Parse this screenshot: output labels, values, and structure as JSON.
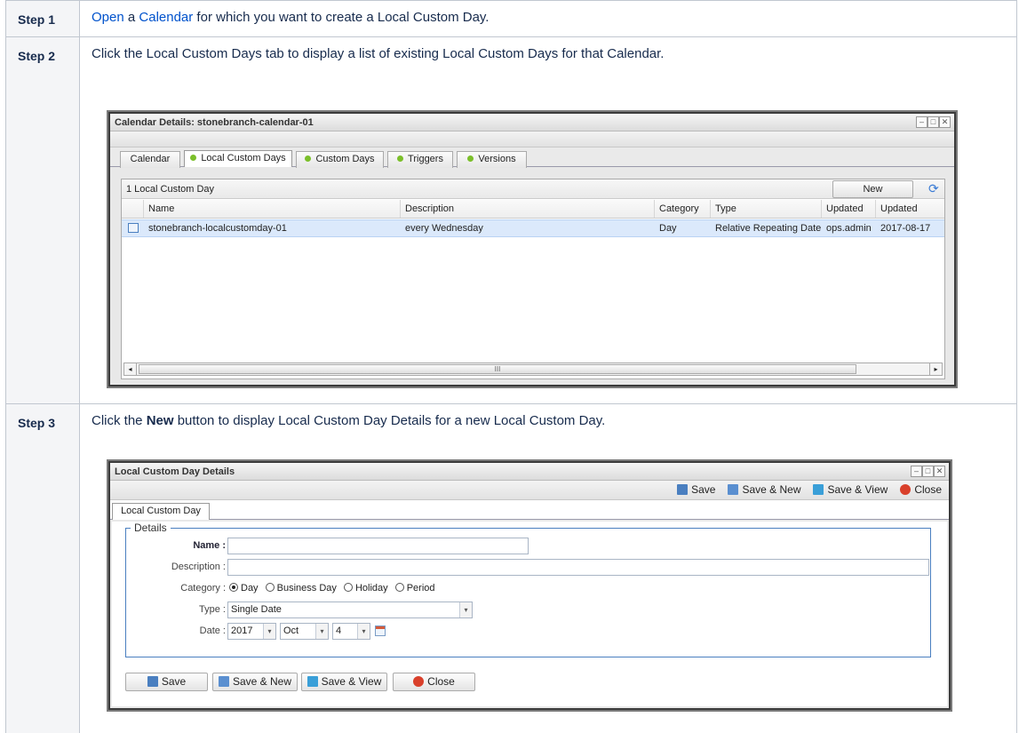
{
  "steps": [
    {
      "label": "Step 1"
    },
    {
      "label": "Step 2",
      "text": "Click the Local Custom Days tab to display a list of existing Local Custom Days for that Calendar."
    },
    {
      "label": "Step 3",
      "text_pre": "Click the ",
      "text_bold": "New",
      "text_post": " button to display Local Custom Day Details for a new Local Custom Day."
    }
  ],
  "step1": {
    "link1": "Open",
    "mid": " a ",
    "link2": "Calendar",
    "post": " for which you want to create a Local Custom Day."
  },
  "win1": {
    "title": "Calendar Details: stonebranch-calendar-01",
    "tabs": [
      "Calendar",
      "Local Custom Days",
      "Custom Days",
      "Triggers",
      "Versions"
    ],
    "count": "1 Local Custom Day",
    "new_button": "New",
    "columns": [
      "Name",
      "Description",
      "Category",
      "Type",
      "Updated By",
      "Updated"
    ],
    "rows": [
      {
        "name": "stonebranch-localcustomday-01",
        "description": "every Wednesday",
        "category": "Day",
        "type": "Relative Repeating Date",
        "updated_by": "ops.admin",
        "updated": "2017-08-17"
      }
    ],
    "scroll_mark": "III"
  },
  "win2": {
    "title": "Local Custom Day Details",
    "toolbar": {
      "save": "Save",
      "save_new": "Save & New",
      "save_view": "Save & View",
      "close": "Close"
    },
    "tab": "Local Custom Day",
    "legend": "Details",
    "labels": {
      "name": "Name :",
      "description": "Description :",
      "category": "Category :",
      "type": "Type :",
      "date": "Date :"
    },
    "categories": [
      "Day",
      "Business Day",
      "Holiday",
      "Period"
    ],
    "selected_category": "Day",
    "type_value": "Single Date",
    "date": {
      "year": "2017",
      "month": "Oct",
      "day": "4"
    },
    "bottom": {
      "save": "Save",
      "save_new": "Save & New",
      "save_view": "Save & View",
      "close": "Close"
    }
  },
  "colors": {
    "accent": "#0052cc",
    "selection": "#dbe9fb",
    "status_dot": "#7bbf2a",
    "close_red": "#d9402b"
  }
}
